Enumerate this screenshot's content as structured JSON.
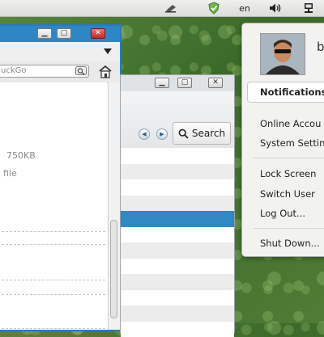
{
  "top_panel": {
    "language": "en"
  },
  "browser_window": {
    "address_text": "uckGo",
    "file_size": "750KB",
    "file_label": "file"
  },
  "file_window": {
    "search_label": "Search",
    "row_colors": [
      "#ffffff",
      "#ececec",
      "#ffffff",
      "#ececec",
      "#3088c4",
      "#ffffff",
      "#ececec",
      "#ffffff",
      "#ececec",
      "#ffffff",
      "#ececec",
      "#ffffff"
    ]
  },
  "system_menu": {
    "user_initial": "b",
    "items": {
      "notifications": "Notifications",
      "online_accounts": "Online Accou",
      "system_settings": "System Settin",
      "lock_screen": "Lock Screen",
      "switch_user": "Switch User",
      "log_out": "Log Out...",
      "shut_down": "Shut Down..."
    }
  },
  "colors": {
    "accent": "#2f86c4",
    "selected_row": "#3088c4",
    "desktop": "#3f6a2e"
  }
}
